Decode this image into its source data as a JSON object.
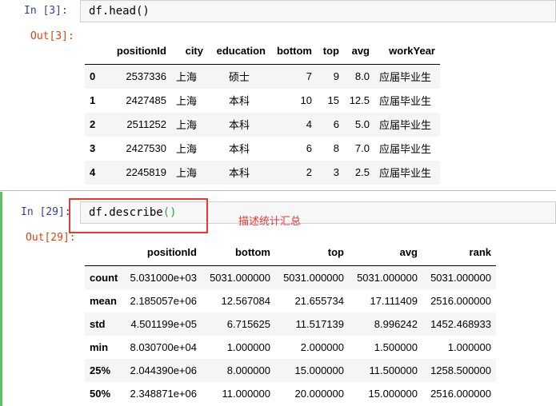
{
  "cell1": {
    "in_prompt": "In  [3]:",
    "code": "df.head()",
    "out_prompt": "Out[3]:",
    "columns": [
      "",
      "positionId",
      "city",
      "education",
      "bottom",
      "top",
      "avg",
      "workYear"
    ],
    "rows": [
      [
        "0",
        "2537336",
        "上海",
        "硕士",
        "7",
        "9",
        "8.0",
        "应届毕业生"
      ],
      [
        "1",
        "2427485",
        "上海",
        "本科",
        "10",
        "15",
        "12.5",
        "应届毕业生"
      ],
      [
        "2",
        "2511252",
        "上海",
        "本科",
        "4",
        "6",
        "5.0",
        "应届毕业生"
      ],
      [
        "3",
        "2427530",
        "上海",
        "本科",
        "6",
        "8",
        "7.0",
        "应届毕业生"
      ],
      [
        "4",
        "2245819",
        "上海",
        "本科",
        "2",
        "3",
        "2.5",
        "应届毕业生"
      ]
    ]
  },
  "cell2": {
    "in_prompt": "In  [29]:",
    "code_name": "df.describe",
    "code_paren": "()",
    "out_prompt": "Out[29]:",
    "annotation": "描述统计汇总",
    "columns": [
      "",
      "positionId",
      "bottom",
      "top",
      "avg",
      "rank"
    ],
    "rows": [
      [
        "count",
        "5.031000e+03",
        "5031.000000",
        "5031.000000",
        "5031.000000",
        "5031.000000"
      ],
      [
        "mean",
        "2.185057e+06",
        "12.567084",
        "21.655734",
        "17.111409",
        "2516.000000"
      ],
      [
        "std",
        "4.501199e+05",
        "6.715625",
        "11.517139",
        "8.996242",
        "1452.468933"
      ],
      [
        "min",
        "8.030700e+04",
        "1.000000",
        "2.000000",
        "1.500000",
        "1.000000"
      ],
      [
        "25%",
        "2.044390e+06",
        "8.000000",
        "15.000000",
        "11.500000",
        "1258.500000"
      ],
      [
        "50%",
        "2.348871e+06",
        "11.000000",
        "20.000000",
        "15.000000",
        "2516.000000"
      ]
    ]
  }
}
